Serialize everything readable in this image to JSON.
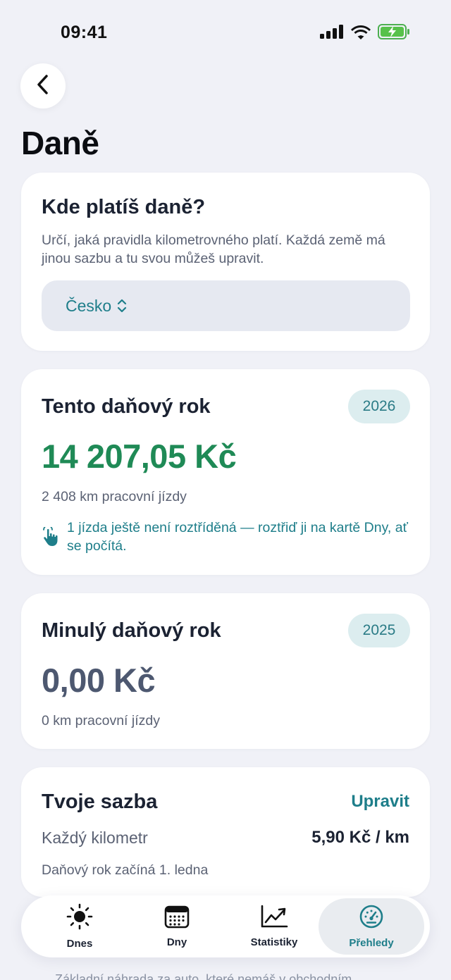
{
  "status_bar": {
    "time": "09:41"
  },
  "header": {
    "title": "Daně"
  },
  "tax_location": {
    "title": "Kde platíš daně?",
    "description": "Určí, jaká pravidla kilometrovného platí. Každá země má jinou sazbu a tu svou můžeš upravit.",
    "selected_country": "Česko"
  },
  "current_year": {
    "title": "Tento daňový rok",
    "year": "2026",
    "amount": "14 207,05 Kč",
    "distance": "2 408 km pracovní jízdy",
    "hint": "1 jízda ještě není roztříděná — roztřiď ji na kartě Dny, ať se počítá."
  },
  "previous_year": {
    "title": "Minulý daňový rok",
    "year": "2025",
    "amount": "0,00 Kč",
    "distance": "0 km pracovní jízdy"
  },
  "rate": {
    "title": "Tvoje sazba",
    "edit_label": "Upravit",
    "row_label": "Každý kilometr",
    "row_value": "5,90 Kč / km",
    "note": "Daňový rok začíná 1. ledna"
  },
  "below_text": "Základní náhrada za auto, které nemáš v obchodním",
  "tabs": [
    {
      "label": "Dnes",
      "icon": "sun-icon"
    },
    {
      "label": "Dny",
      "icon": "calendar-icon"
    },
    {
      "label": "Statistiky",
      "icon": "chart-icon"
    },
    {
      "label": "Přehledy",
      "icon": "gauge-icon"
    }
  ],
  "colors": {
    "accent": "#1e7e8a",
    "positive": "#1f8a56",
    "background": "#f0f1f7"
  }
}
